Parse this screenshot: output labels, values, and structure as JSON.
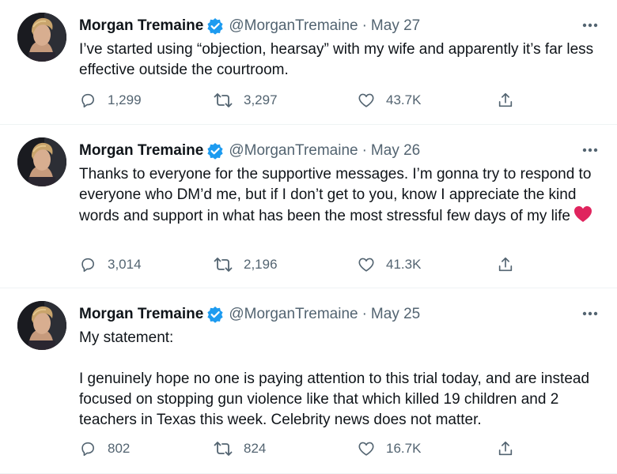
{
  "colors": {
    "text": "#0f1419",
    "secondary": "#536471",
    "verified": "#1d9bf0",
    "heart": "#e0245e",
    "divider": "#eff3f4"
  },
  "icons": {
    "reply": "reply-icon",
    "retweet": "retweet-icon",
    "like": "like-icon",
    "share": "share-icon",
    "more": "more-icon",
    "verified": "verified-badge-icon",
    "emoji": "red-heart-emoji"
  },
  "tweets": [
    {
      "name": "Morgan Tremaine",
      "handle": "@MorganTremaine",
      "separator": "·",
      "date": "May 27",
      "text": "I’ve started using “objection, hearsay” with my wife and apparently it’s far less effective outside the courtroom.",
      "replies": "1,299",
      "retweets": "3,297",
      "likes": "43.7K"
    },
    {
      "name": "Morgan Tremaine",
      "handle": "@MorganTremaine",
      "separator": "·",
      "date": "May 26",
      "text": "Thanks to everyone for the supportive messages. I’m gonna try to respond to everyone who DM’d me, but if I don’t get to you, know I appreciate the kind words and support in what has been the most stressful few days of my life",
      "replies": "3,014",
      "retweets": "2,196",
      "likes": "41.3K"
    },
    {
      "name": "Morgan Tremaine",
      "handle": "@MorganTremaine",
      "separator": "·",
      "date": "May 25",
      "text": "My statement:",
      "text2": "I genuinely hope no one is paying attention to this trial today, and are instead focused on stopping gun violence like that which killed 19 children and 2 teachers in Texas this week. Celebrity news does not matter.",
      "replies": "802",
      "retweets": "824",
      "likes": "16.7K"
    }
  ]
}
